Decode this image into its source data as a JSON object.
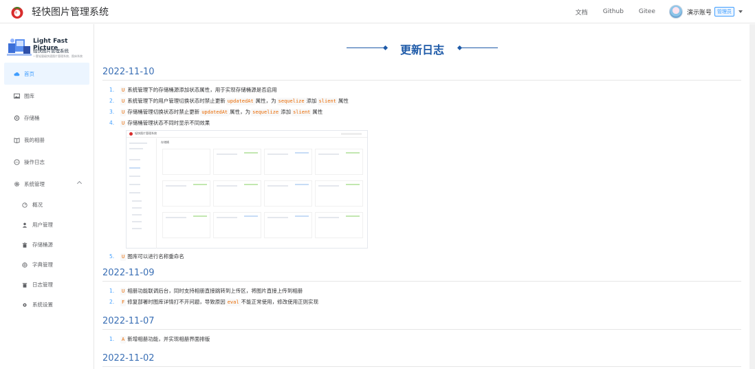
{
  "header": {
    "app_title": "轻快图片管理系统",
    "links": [
      "文档",
      "Github",
      "Gitee"
    ],
    "user_name": "演示账号",
    "role": "管理员"
  },
  "brand": {
    "en": "Light Fast Picture",
    "cn": "轻快图片管理系统",
    "sub": "一套轻量级快速图片管理系统、图床系统"
  },
  "sidebar": {
    "items": [
      {
        "label": "首页",
        "icon": "cloud-icon"
      },
      {
        "label": "图库",
        "icon": "image-icon"
      },
      {
        "label": "存储桶",
        "icon": "bucket-icon"
      },
      {
        "label": "我的相册",
        "icon": "album-icon"
      },
      {
        "label": "操作日志",
        "icon": "chat-icon"
      },
      {
        "label": "系统管理",
        "icon": "gear-icon"
      }
    ],
    "sub_items": [
      {
        "label": "概况",
        "icon": "dashboard-icon"
      },
      {
        "label": "用户管理",
        "icon": "user-icon"
      },
      {
        "label": "存储桶源",
        "icon": "trash-icon"
      },
      {
        "label": "字典管理",
        "icon": "dict-icon"
      },
      {
        "label": "日志管理",
        "icon": "log-icon"
      },
      {
        "label": "系统设置",
        "icon": "settings-icon"
      }
    ]
  },
  "page": {
    "title": "更新日志"
  },
  "versions": [
    {
      "date": "2022-11-10",
      "items": [
        {
          "num": "1.",
          "tag": "U",
          "parts": [
            "系统管理下的存储桶源添加状态属性，用于实现存储桶源是否启用"
          ]
        },
        {
          "num": "2.",
          "tag": "U",
          "parts": [
            "系统管理下的用户管理切换状态时禁止更新",
            "updatedAt",
            "属性，为",
            "sequelize",
            "添加",
            "slient",
            "属性"
          ]
        },
        {
          "num": "3.",
          "tag": "U",
          "parts": [
            "存储桶管理切换状态时禁止更新",
            "updatedAt",
            "属性，为",
            "sequelize",
            "添加",
            "slient",
            "属性"
          ]
        },
        {
          "num": "4.",
          "tag": "U",
          "parts": [
            "存储桶管理状态不同时显示不同效果"
          ]
        },
        {
          "num": "5.",
          "tag": "U",
          "parts": [
            "图库可以进行名称重命名"
          ]
        }
      ]
    },
    {
      "date": "2022-11-09",
      "items": [
        {
          "num": "1.",
          "tag": "U",
          "parts": [
            "相册功能联调后台，同时支持相册直接跳转到上传区，将图片直接上传到相册"
          ]
        },
        {
          "num": "2.",
          "tag": "F",
          "parts": [
            "修复部署时图库详情打不开问题，导致原因",
            "eval",
            "不能正常使用，修改使用正则实现"
          ]
        }
      ]
    },
    {
      "date": "2022-11-07",
      "items": [
        {
          "num": "1.",
          "tag": "A",
          "parts": [
            "新增相册功能，并实现相册界面排版"
          ]
        }
      ]
    },
    {
      "date": "2022-11-02",
      "items": []
    }
  ],
  "screenshot": {
    "app_title": "轻快图片管理系统",
    "header_link": "存储桶"
  },
  "colors": {
    "accent": "#409eff",
    "title": "#1e5aa8",
    "tag_text": "#e96900"
  }
}
